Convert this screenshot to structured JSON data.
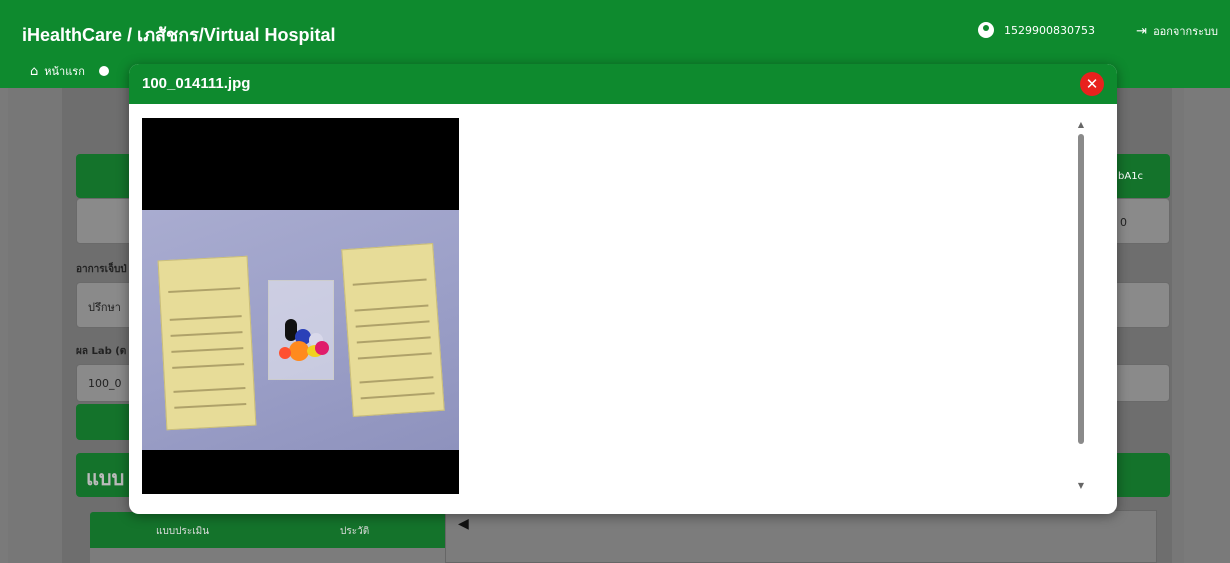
{
  "app": {
    "title": "iHealthCare / เภสัชกร/Virtual Hospital",
    "user_id": "1529900830753",
    "logout_label": "ออกจากระบบ",
    "nav_home": "หน้าแรก"
  },
  "background": {
    "right_header_label": "bA1c",
    "right_value": "0",
    "symptom_label": "อาการเจ็บป่",
    "symptom_value": "ปรึกษา",
    "lab_label": "ผล Lab (ต",
    "lab_value": "100_0",
    "section_title": "แบบ",
    "tab_form": "แบบประเมิน",
    "tab_history": "ประวัติ"
  },
  "modal": {
    "title": "100_014111.jpg",
    "close_icon": "close-icon",
    "image_description_icon": "medication-photo",
    "colors": {
      "header": "#0e8a2e",
      "close": "#e8211d"
    }
  }
}
